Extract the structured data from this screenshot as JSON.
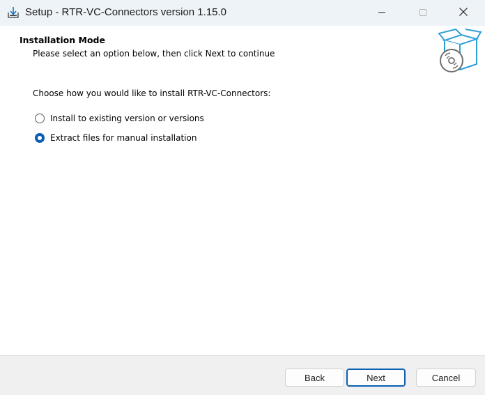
{
  "window": {
    "title": "Setup - RTR-VC-Connectors version 1.15.0",
    "app_icon": "installer-download-icon",
    "controls": {
      "minimize": "minimize-icon",
      "maximize": "maximize-icon",
      "close": "close-icon"
    }
  },
  "header": {
    "title": "Installation Mode",
    "subtitle": "Please select an option below, then click Next to continue",
    "logo": "box-disc-icon"
  },
  "content": {
    "prompt": "Choose how you would like to install RTR-VC-Connectors:",
    "options": [
      {
        "label": "Install to existing version or versions",
        "selected": false
      },
      {
        "label": "Extract files for manual installation",
        "selected": true
      }
    ]
  },
  "footer": {
    "back_label": "Back",
    "next_label": "Next",
    "cancel_label": "Cancel"
  },
  "colors": {
    "accent": "#0a5fb4",
    "titlebar": "#eef3f8",
    "footer": "#f0f0f0",
    "logo": "#2e9fd8"
  }
}
